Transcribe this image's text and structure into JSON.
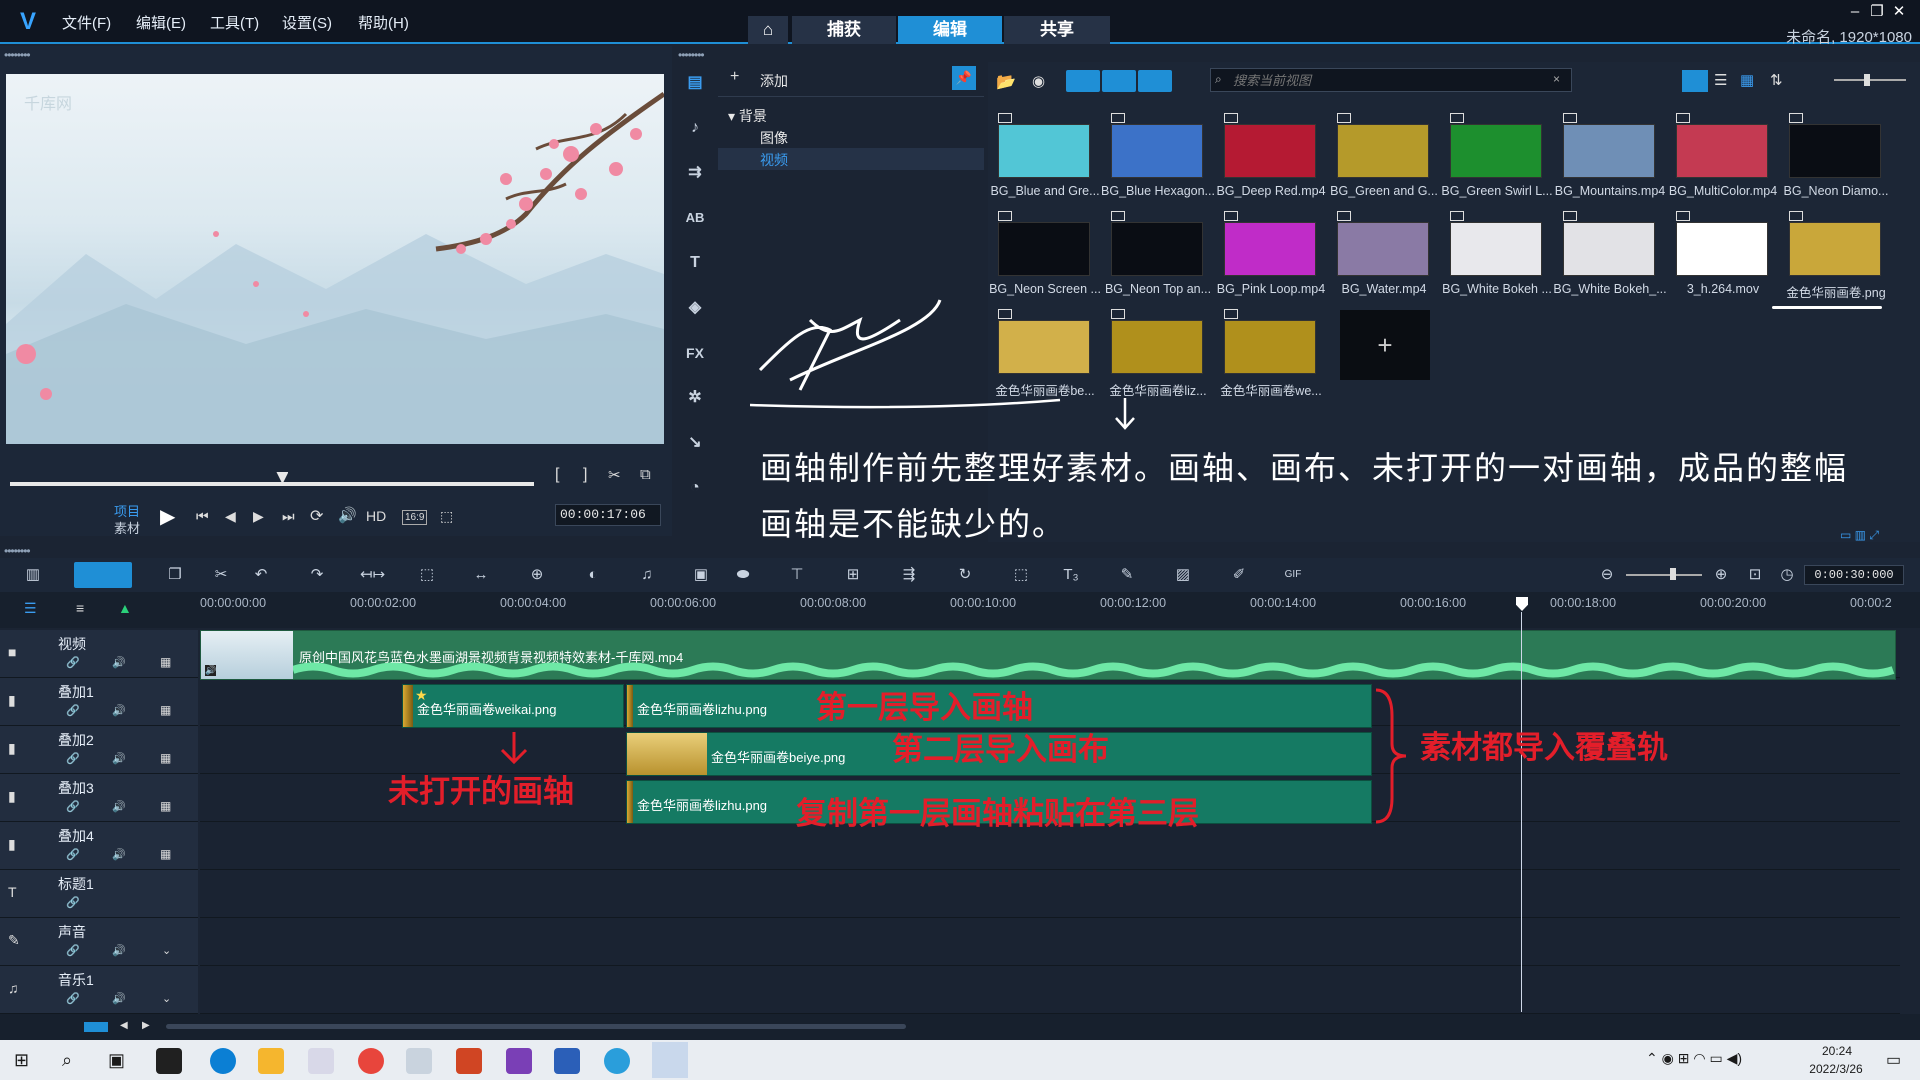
{
  "menubar": {
    "items": [
      "文件(F)",
      "编辑(E)",
      "工具(T)",
      "设置(S)",
      "帮助(H)"
    ]
  },
  "mode_tabs": {
    "home_icon": "home-icon",
    "capture": "捕获",
    "edit": "编辑",
    "share": "共享"
  },
  "project": {
    "name": "未命名, 1920*1080"
  },
  "preview": {
    "project_label": "项目",
    "clip_label": "素材",
    "hd": "HD",
    "aspect": "16:9",
    "timecode": "00:00:17:06",
    "watermark": "千库网",
    "position": 0.52
  },
  "library": {
    "add_label": "添加",
    "tree": {
      "root": "背景",
      "children": [
        "图像",
        "视频"
      ],
      "selected": "视频"
    },
    "search_placeholder": "搜索当前视图",
    "icons": [
      "media-icon",
      "instant-project-icon",
      "transition-icon",
      "title-icon",
      "text-icon",
      "graphics-icon",
      "fx-icon",
      "motion-icon",
      "path-icon",
      "speedometer-icon"
    ]
  },
  "gallery": {
    "items": [
      {
        "label": "BG_Blue and Gre...",
        "color": "#52c6d6"
      },
      {
        "label": "BG_Blue Hexagon...",
        "color": "#3c72c8"
      },
      {
        "label": "BG_Deep Red.mp4",
        "color": "#b51a33"
      },
      {
        "label": "BG_Green and G...",
        "color": "#b59a2a"
      },
      {
        "label": "BG_Green Swirl L...",
        "color": "#1d8f2e"
      },
      {
        "label": "BG_Mountains.mp4",
        "color": "#6f8fb6"
      },
      {
        "label": "BG_MultiColor.mp4",
        "color": "#c43a52"
      },
      {
        "label": "BG_Neon Diamo...",
        "color": "#0a0d14"
      },
      {
        "label": "BG_Neon Screen ...",
        "color": "#0a0d14"
      },
      {
        "label": "BG_Neon Top an...",
        "color": "#0a0d14"
      },
      {
        "label": "BG_Pink Loop.mp4",
        "color": "#c02cc8"
      },
      {
        "label": "BG_Water.mp4",
        "color": "#8a7aa5"
      },
      {
        "label": "BG_White Bokeh ...",
        "color": "#e8e8ec"
      },
      {
        "label": "BG_White Bokeh_...",
        "color": "#e2e2e6"
      },
      {
        "label": "3_h.264.mov",
        "color": "#ffffff"
      },
      {
        "label": "金色华丽画卷.png",
        "color": "#c9a73a"
      },
      {
        "label": "金色华丽画卷be...",
        "color": "#d2b04a"
      },
      {
        "label": "金色华丽画卷liz...",
        "color": "#b0901c"
      },
      {
        "label": "金色华丽画卷we...",
        "color": "#b0901c"
      }
    ],
    "add_tile_icon": "plus-icon"
  },
  "annotation_main": "画轴制作前先整理好素材。画轴、画布、未打开的一对画轴，成品的整幅画轴是不能缺少的。",
  "timeline": {
    "duration": "0:00:30:000",
    "ruler": [
      "00:00:00:00",
      "00:00:02:00",
      "00:00:04:00",
      "00:00:06:00",
      "00:00:08:00",
      "00:00:10:00",
      "00:00:12:00",
      "00:00:14:00",
      "00:00:16:00",
      "00:00:18:00",
      "00:00:20:00",
      "00:00:2"
    ],
    "tracks": [
      "视频",
      "叠加1",
      "叠加2",
      "叠加3",
      "叠加4",
      "标题1",
      "声音",
      "音乐1"
    ],
    "video_clip": "原创中国风花鸟蓝色水墨画湖景视频背景视频特效素材-千库网.mp4",
    "overlay1_clips": [
      "金色华丽画卷weikai.png",
      "金色华丽画卷lizhu.png"
    ],
    "overlay2_clip": "金色华丽画卷beiye.png",
    "overlay3_clip": "金色华丽画卷lizhu.png"
  },
  "annotations": {
    "layer1": "第一层导入画轴",
    "layer2": "第二层导入画布",
    "layer3": "复制第一层画轴粘贴在第三层",
    "unopened": "未打开的画轴",
    "overlay": "素材都导入覆叠轨"
  },
  "taskbar": {
    "time": "20:24",
    "date": "2022/3/26"
  }
}
